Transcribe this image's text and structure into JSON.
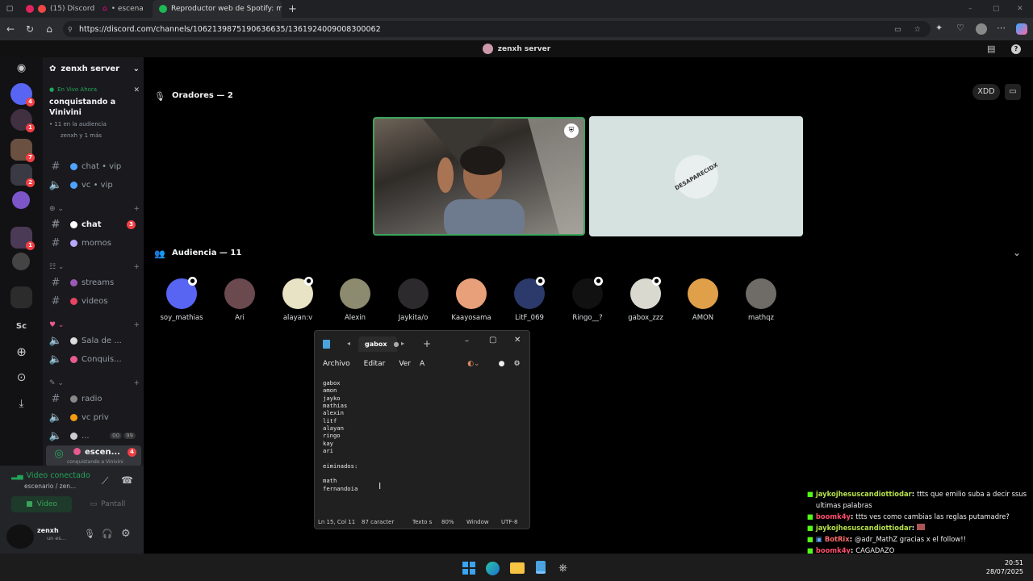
{
  "browser": {
    "tabs": [
      {
        "label": "(15) Discord |",
        "active": false
      },
      {
        "label": "• escena",
        "active": false
      },
      {
        "label": "Reproductor web de Spotify: mú",
        "active": true
      }
    ],
    "url": "https://discord.com/channels/1062139875190636635/1361924009008300062"
  },
  "top_title": "zenxh server",
  "server_name": "zenxh server",
  "live": {
    "status": "En Vivo Ahora",
    "title": "conquistando a Vinivini",
    "audience": "• 11 en la audiencia",
    "people": "zenxh y 1 más"
  },
  "channels": [
    {
      "type": "text",
      "label": "chat • vip"
    },
    {
      "type": "voice",
      "label": "vc • vip"
    },
    {
      "type": "text",
      "label": "chat",
      "badge": "3"
    },
    {
      "type": "text",
      "label": "momos"
    },
    {
      "type": "text",
      "label": "streams"
    },
    {
      "type": "text",
      "label": "videos"
    },
    {
      "type": "voice",
      "label": "Sala de ..."
    },
    {
      "type": "voice",
      "label": "Conquis..."
    },
    {
      "type": "text",
      "label": "radio"
    },
    {
      "type": "voice",
      "label": "vc priv"
    },
    {
      "type": "voice",
      "label": "...",
      "counter": "00",
      "counter2": "99"
    },
    {
      "type": "stage",
      "label": "escen...",
      "badge": "4",
      "sub": "conquistando a Vinivini"
    }
  ],
  "servers_badges": [
    "4",
    "1",
    "7",
    "2",
    "1"
  ],
  "voice_panel": {
    "status": "Video conectado",
    "channel": "escenario / zen...",
    "video_btn": "Video",
    "screen_btn": "Pantall"
  },
  "user": {
    "name": "zenxh",
    "status": "un es..."
  },
  "stage": {
    "speakers_label": "Oradores — 2",
    "audience_label": "Audiencia — 11",
    "xdd_btn": "XDD",
    "avatar_text": "DESAPARECIDX",
    "audience": [
      "soy_mathias",
      "Ari",
      "alayan:v",
      "Alexin",
      "Jaykita/o",
      "Kaayosama",
      "LitF_069",
      "Ringo__?",
      "gabox_zzz",
      "AMON",
      "mathqz"
    ]
  },
  "notepad": {
    "tab": "gabox",
    "menu": [
      "Archivo",
      "Editar",
      "Ver"
    ],
    "lines": [
      "gabox",
      "amon",
      "jayko",
      "mathias",
      "alexin",
      "litf",
      "alayan",
      "ringo",
      "kay",
      "ari",
      "",
      "eiminados:",
      "",
      "math",
      "fernandoia"
    ],
    "status": [
      "Ln 15, Col 11",
      "87 caracter",
      "Texto s",
      "80%",
      "Window",
      "UTF-8"
    ]
  },
  "chat": [
    {
      "user": "jaykojhesuscandiottiodar",
      "msg": "ttts que emilio suba a decir ssus ultimas palabras"
    },
    {
      "user": "boomk4y",
      "msg": "ttts ves como cambias las reglas putamadre?"
    },
    {
      "user": "jaykojhesuscandiottiodar",
      "msg": ""
    },
    {
      "user": "BotRix",
      "msg": "@adr_MathZ gracias x el follow!!"
    },
    {
      "user": "boomk4y",
      "msg": "CAGADAZO"
    }
  ],
  "clock": {
    "time": "20:51",
    "date": "28/07/2025"
  }
}
